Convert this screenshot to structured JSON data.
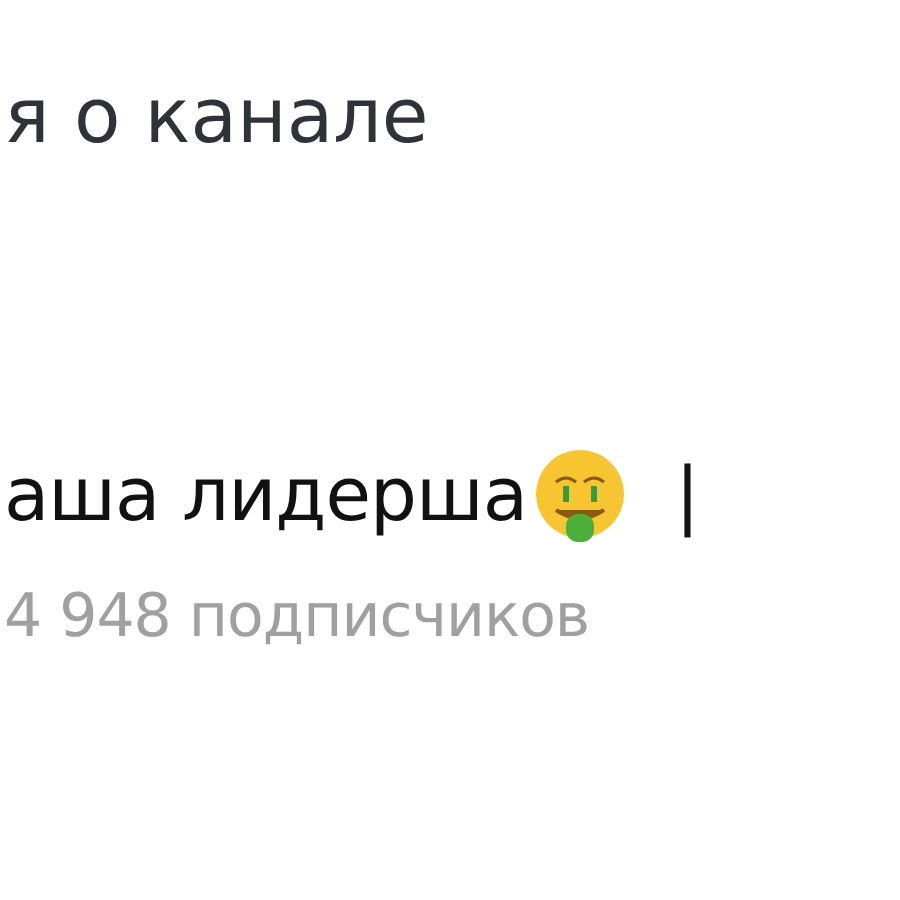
{
  "header": {
    "title": "я о канале"
  },
  "channel": {
    "name": "аша лидерша",
    "separator": "|",
    "subscribers": "4 948 подписчиков"
  }
}
